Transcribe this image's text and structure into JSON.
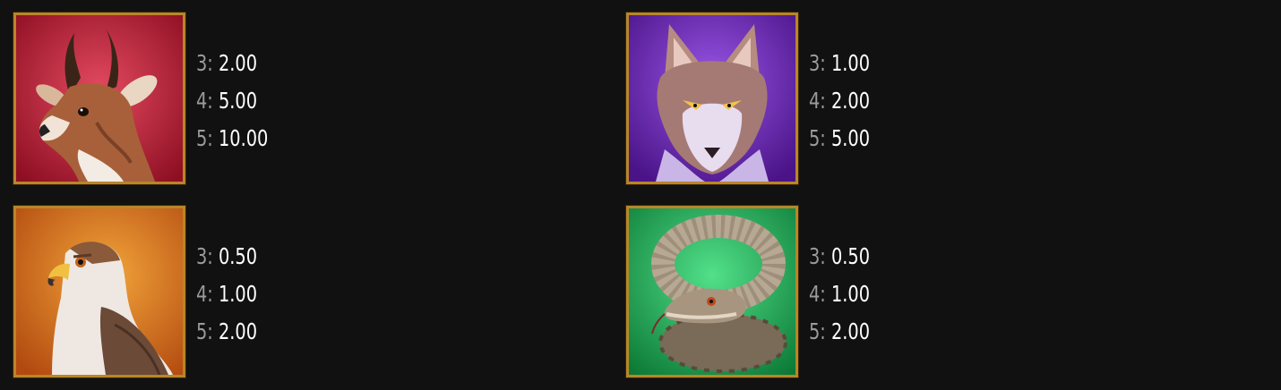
{
  "symbols": [
    {
      "icon": "pronghorn-icon",
      "background": "#c81e3a",
      "payouts": [
        {
          "count": "3:",
          "value": "2.00"
        },
        {
          "count": "4:",
          "value": "5.00"
        },
        {
          "count": "5:",
          "value": "10.00"
        }
      ]
    },
    {
      "icon": "wolf-icon",
      "background": "#6a2bb0",
      "payouts": [
        {
          "count": "3:",
          "value": "1.00"
        },
        {
          "count": "4:",
          "value": "2.00"
        },
        {
          "count": "5:",
          "value": "5.00"
        }
      ]
    },
    {
      "icon": "hawk-icon",
      "background": "#e0801a",
      "payouts": [
        {
          "count": "3:",
          "value": "0.50"
        },
        {
          "count": "4:",
          "value": "1.00"
        },
        {
          "count": "5:",
          "value": "2.00"
        }
      ]
    },
    {
      "icon": "snake-icon",
      "background": "#1fb85a",
      "payouts": [
        {
          "count": "3:",
          "value": "0.50"
        },
        {
          "count": "4:",
          "value": "1.00"
        },
        {
          "count": "5:",
          "value": "2.00"
        }
      ]
    }
  ],
  "frame_color": "#b8862a"
}
